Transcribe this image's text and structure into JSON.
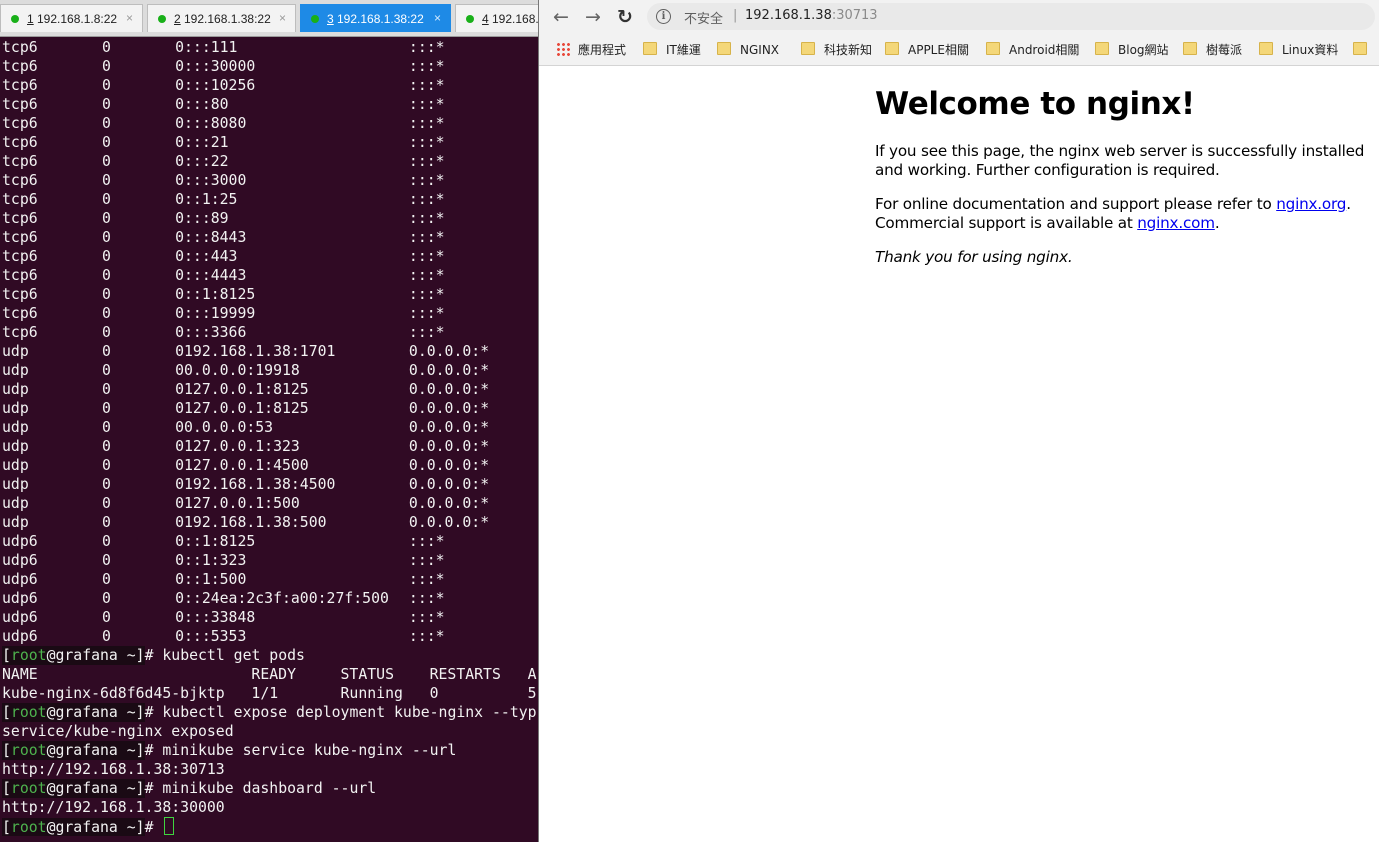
{
  "terminal": {
    "tabs": [
      {
        "num": "1",
        "host": " 192.168.1.8:22",
        "active": false
      },
      {
        "num": "2",
        "host": " 192.168.1.38:22",
        "active": false
      },
      {
        "num": "3",
        "host": " 192.168.1.38:22",
        "active": true
      },
      {
        "num": "4",
        "host": " 192.168.1.",
        "active": false
      }
    ],
    "close_glyph": "×",
    "netstat_rows": [
      [
        "tcp6",
        "0",
        "0",
        ":::111",
        ":::*"
      ],
      [
        "tcp6",
        "0",
        "0",
        ":::30000",
        ":::*"
      ],
      [
        "tcp6",
        "0",
        "0",
        ":::10256",
        ":::*"
      ],
      [
        "tcp6",
        "0",
        "0",
        ":::80",
        ":::*"
      ],
      [
        "tcp6",
        "0",
        "0",
        ":::8080",
        ":::*"
      ],
      [
        "tcp6",
        "0",
        "0",
        ":::21",
        ":::*"
      ],
      [
        "tcp6",
        "0",
        "0",
        ":::22",
        ":::*"
      ],
      [
        "tcp6",
        "0",
        "0",
        ":::3000",
        ":::*"
      ],
      [
        "tcp6",
        "0",
        "0",
        "::1:25",
        ":::*"
      ],
      [
        "tcp6",
        "0",
        "0",
        ":::89",
        ":::*"
      ],
      [
        "tcp6",
        "0",
        "0",
        ":::8443",
        ":::*"
      ],
      [
        "tcp6",
        "0",
        "0",
        ":::443",
        ":::*"
      ],
      [
        "tcp6",
        "0",
        "0",
        ":::4443",
        ":::*"
      ],
      [
        "tcp6",
        "0",
        "0",
        "::1:8125",
        ":::*"
      ],
      [
        "tcp6",
        "0",
        "0",
        ":::19999",
        ":::*"
      ],
      [
        "tcp6",
        "0",
        "0",
        ":::3366",
        ":::*"
      ],
      [
        "udp",
        "0",
        "0",
        "192.168.1.38:1701",
        "0.0.0.0:*"
      ],
      [
        "udp",
        "0",
        "0",
        "0.0.0.0:19918",
        "0.0.0.0:*"
      ],
      [
        "udp",
        "0",
        "0",
        "127.0.0.1:8125",
        "0.0.0.0:*"
      ],
      [
        "udp",
        "0",
        "0",
        "127.0.0.1:8125",
        "0.0.0.0:*"
      ],
      [
        "udp",
        "0",
        "0",
        "0.0.0.0:53",
        "0.0.0.0:*"
      ],
      [
        "udp",
        "0",
        "0",
        "127.0.0.1:323",
        "0.0.0.0:*"
      ],
      [
        "udp",
        "0",
        "0",
        "127.0.0.1:4500",
        "0.0.0.0:*"
      ],
      [
        "udp",
        "0",
        "0",
        "192.168.1.38:4500",
        "0.0.0.0:*"
      ],
      [
        "udp",
        "0",
        "0",
        "127.0.0.1:500",
        "0.0.0.0:*"
      ],
      [
        "udp",
        "0",
        "0",
        "192.168.1.38:500",
        "0.0.0.0:*"
      ],
      [
        "udp6",
        "0",
        "0",
        "::1:8125",
        ":::*"
      ],
      [
        "udp6",
        "0",
        "0",
        "::1:323",
        ":::*"
      ],
      [
        "udp6",
        "0",
        "0",
        "::1:500",
        ":::*"
      ],
      [
        "udp6",
        "0",
        "0",
        "::24ea:2c3f:a00:27f:500",
        ":::*"
      ],
      [
        "udp6",
        "0",
        "0",
        ":::33848",
        ":::*"
      ],
      [
        "udp6",
        "0",
        "0",
        ":::5353",
        ":::*"
      ]
    ],
    "prompt": {
      "open": "[",
      "user": "root",
      "host": "@grafana ~]",
      "symbol": "# "
    },
    "session": [
      {
        "type": "cmd",
        "text": "kubectl get pods"
      },
      {
        "type": "out",
        "text": "NAME                        READY     STATUS    RESTARTS   A"
      },
      {
        "type": "out",
        "text": "kube-nginx-6d8f6d45-bjktp   1/1       Running   0          5"
      },
      {
        "type": "cmd",
        "text": "kubectl expose deployment kube-nginx --typ"
      },
      {
        "type": "out",
        "text": "service/kube-nginx exposed"
      },
      {
        "type": "cmd",
        "text": "minikube service kube-nginx --url"
      },
      {
        "type": "out",
        "text": "http://192.168.1.38:30713"
      },
      {
        "type": "cmd",
        "text": "minikube dashboard --url"
      },
      {
        "type": "out",
        "text": "http://192.168.1.38:30000"
      },
      {
        "type": "cmd",
        "text": "",
        "cursor": true
      }
    ]
  },
  "browser": {
    "back_icon": "←",
    "forward_icon": "→",
    "reload_icon": "↻",
    "info_icon": "i",
    "insecure_label": "不安全",
    "separator": "|",
    "url_host": "192.168.1.38",
    "url_port": ":30713",
    "bookmarks": [
      {
        "label": "應用程式",
        "type": "apps"
      },
      {
        "label": "IT維運",
        "type": "folder"
      },
      {
        "label": "NGINX",
        "type": "folder"
      },
      {
        "label": "科技新知",
        "type": "folder"
      },
      {
        "label": "APPLE相關",
        "type": "folder"
      },
      {
        "label": "Android相關",
        "type": "folder"
      },
      {
        "label": "Blog網站",
        "type": "folder"
      },
      {
        "label": "樹莓派",
        "type": "folder"
      },
      {
        "label": "Linux資料",
        "type": "folder"
      },
      {
        "label": "",
        "type": "folder"
      }
    ],
    "page": {
      "heading": "Welcome to nginx!",
      "para1": "If you see this page, the nginx web server is successfully installed and working. Further configuration is required.",
      "para2_pre": "For online documentation and support please refer to ",
      "link1": "nginx.org",
      "para2_mid": ".",
      "para2_line2_pre": "Commercial support is available at ",
      "link2": "nginx.com",
      "para2_end": ".",
      "thanks": "Thank you for using nginx."
    }
  },
  "colors": {
    "terminal_bg": "#300a24",
    "active_tab": "#1e8ae6",
    "prompt_user": "#4eb34e",
    "link": "#0000ee"
  }
}
